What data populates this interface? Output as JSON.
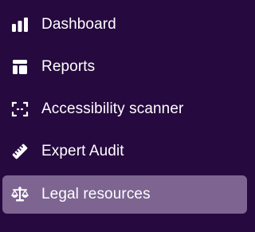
{
  "sidebar": {
    "items": [
      {
        "label": "Dashboard",
        "icon": "bar-chart-icon",
        "active": false
      },
      {
        "label": "Reports",
        "icon": "table-icon",
        "active": false
      },
      {
        "label": "Accessibility scanner",
        "icon": "scan-icon",
        "active": false
      },
      {
        "label": "Expert Audit",
        "icon": "ruler-icon",
        "active": false
      },
      {
        "label": "Legal resources",
        "icon": "scale-icon",
        "active": true
      }
    ]
  },
  "colors": {
    "background": "#26093f",
    "active_background": "#7d6491",
    "text": "#ffffff"
  }
}
